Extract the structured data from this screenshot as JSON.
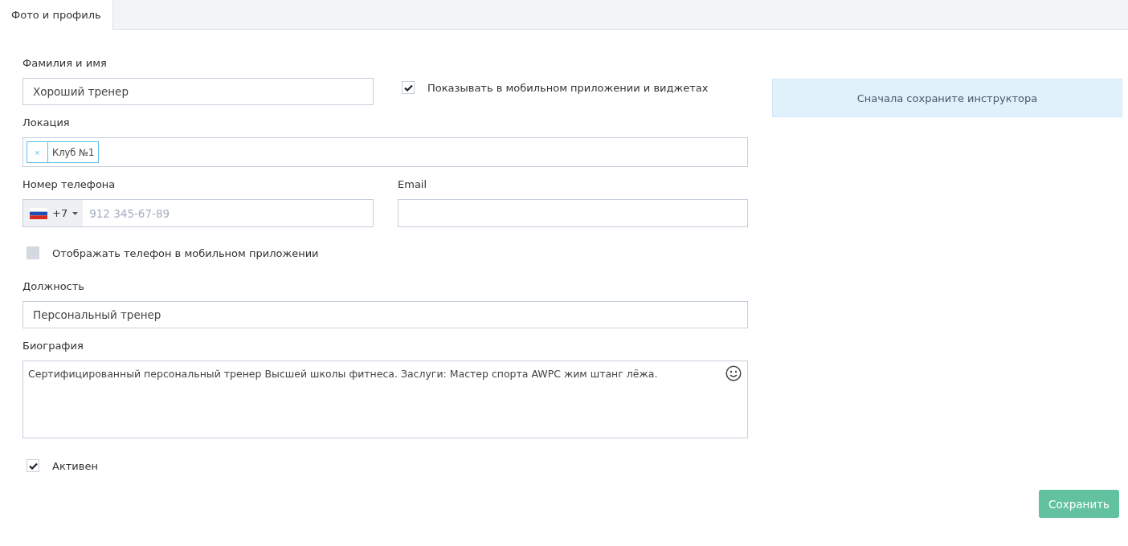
{
  "tabs": [
    {
      "label": "Фото и профиль",
      "selected": true
    }
  ],
  "name_field": {
    "label": "Фамилия и имя",
    "value": "Хороший тренер"
  },
  "show_in_app": {
    "label": "Показывать в мобильном приложении и виджетах",
    "checked": true
  },
  "location": {
    "label": "Локация",
    "tags": [
      {
        "remove": "×",
        "label": "Клуб №1"
      }
    ]
  },
  "phone": {
    "label": "Номер телефона",
    "country_code": "+7",
    "placeholder": "912 345-67-89"
  },
  "email": {
    "label": "Email"
  },
  "show_phone": {
    "label": "Отображать телефон в мобильном приложении",
    "checked": false
  },
  "position": {
    "label": "Должность",
    "value": "Персональный тренер"
  },
  "biography": {
    "label": "Биография",
    "value": "Сертифицированный персональный тренер Высшей школы фитнеса. Заслуги: Мастер спорта AWPC жим штанг лёжа."
  },
  "active": {
    "label": "Активен",
    "checked": true
  },
  "notice": "Сначала сохраните инструктора",
  "save_button": "Сохранить"
}
